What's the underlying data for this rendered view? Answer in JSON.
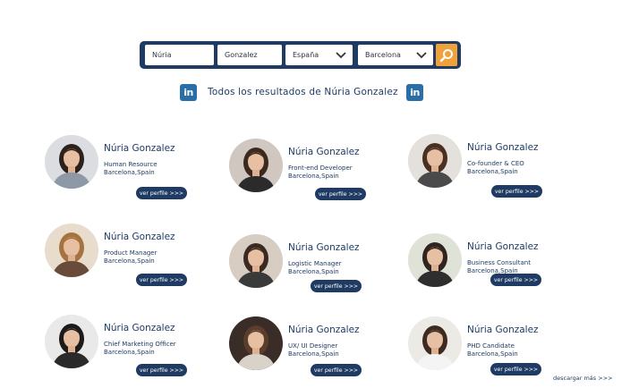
{
  "search": {
    "first_name": "Núria",
    "last_name": "Gonzalez",
    "country": "España",
    "city": "Barcelona"
  },
  "results_header": {
    "title": "Todos los resultados de Núria Gonzalez",
    "linkedin_glyph": "in"
  },
  "profiles": [
    {
      "name": "Núria Gonzalez",
      "role": "Human Resource",
      "location": "Barcelona,Spain",
      "button": "ver perfile >>>"
    },
    {
      "name": "Núria Gonzalez",
      "role": "Front-end Developer",
      "location": "Barcelona,Spain",
      "button": "ver perfile >>>"
    },
    {
      "name": "Núria Gonzalez",
      "role": "Co-founder & CEO",
      "location": "Barcelona,Spain",
      "button": "ver perfile >>>"
    },
    {
      "name": "Núria Gonzalez",
      "role": "Product Manager",
      "location": "Barcelona,Spain",
      "button": "ver perfile >>>"
    },
    {
      "name": "Núria Gonzalez",
      "role": "Logistic Manager",
      "location": "Barcelona,Spain",
      "button": "ver perfile >>>"
    },
    {
      "name": "Núria Gonzalez",
      "role": "Business Consultant",
      "location": "Barcelona,Spain",
      "button": "ver perfile >>>"
    },
    {
      "name": "Núria Gonzalez",
      "role": "Chief Marketing Officer",
      "location": "Barcelona,Spain",
      "button": "ver perfile >>>"
    },
    {
      "name": "Núria Gonzalez",
      "role": "UX/ UI Designer",
      "location": "Barcelona,Spain",
      "button": "ver perfile >>>"
    },
    {
      "name": "Núria Gonzalez",
      "role": "PHD Candidate",
      "location": "Barcelona,Spain",
      "button": "ver perfile >>>"
    }
  ],
  "load_more": "descargar más >>>",
  "icons": {
    "search": "search-icon",
    "linkedin": "linkedin-icon",
    "dropdown": "chevron-down-icon"
  },
  "colors": {
    "navy": "#1f3b63",
    "accent": "#f0a13a",
    "linkedin": "#2a6ea8"
  }
}
